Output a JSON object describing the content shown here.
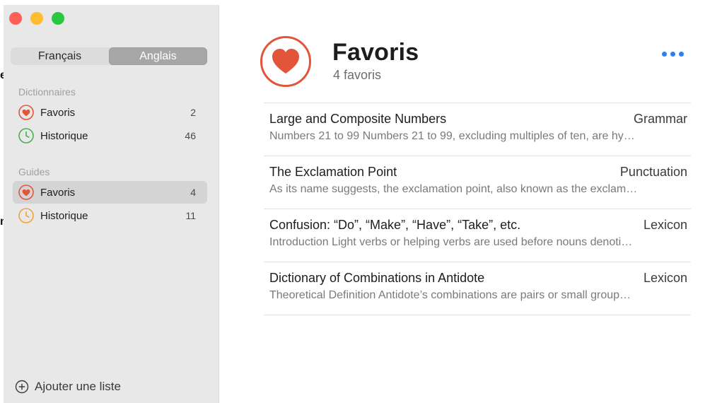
{
  "edge": {
    "glyph_top": "e",
    "glyph_bottom": "n"
  },
  "sidebar": {
    "language_tabs": [
      {
        "label": "Français",
        "active": false
      },
      {
        "label": "Anglais",
        "active": true
      }
    ],
    "sections": [
      {
        "title": "Dictionnaires",
        "items": [
          {
            "label": "Favoris",
            "count": "2",
            "icon": "heart-icon",
            "selected": false
          },
          {
            "label": "Historique",
            "count": "46",
            "icon": "clock-icon",
            "selected": false
          }
        ]
      },
      {
        "title": "Guides",
        "items": [
          {
            "label": "Favoris",
            "count": "4",
            "icon": "heart-icon",
            "selected": true
          },
          {
            "label": "Historique",
            "count": "11",
            "icon": "clock-icon",
            "selected": false
          }
        ]
      }
    ],
    "add_list_label": "Ajouter une liste"
  },
  "main": {
    "title": "Favoris",
    "subtitle": "4 favoris",
    "items": [
      {
        "title": "Large and Composite Numbers",
        "category": "Grammar",
        "snippet": "Numbers 21 to 99 Numbers 21 to 99, excluding multiples of ten, are hy…"
      },
      {
        "title": "The Exclamation Point",
        "category": "Punctuation",
        "snippet": "As its name suggests, the exclamation point, also known as the exclam…"
      },
      {
        "title": "Confusion: “Do”, “Make”, “Have”, “Take”, etc.",
        "category": "Lexicon",
        "snippet": "Introduction Light verbs or helping verbs are used before nouns denoti…"
      },
      {
        "title": "Dictionary of Combinations in Antidote",
        "category": "Lexicon",
        "snippet": "Theoretical Definition Antidote’s combinations are pairs or small group…"
      }
    ]
  },
  "colors": {
    "heart": "#e2553b",
    "clock_green": "#4caf50",
    "clock_orange": "#f0a33a",
    "accent_blue": "#2d7ff9"
  }
}
